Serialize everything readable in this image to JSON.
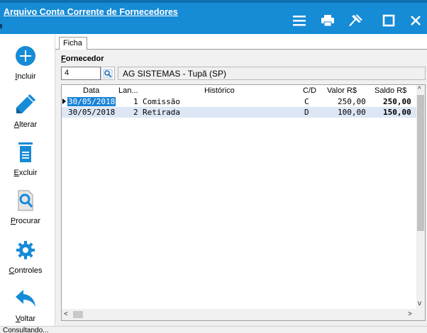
{
  "window": {
    "title": "Arquivo Conta Corrente de Fornecedores",
    "accent": "#168bd6",
    "buttons": [
      "menu-icon",
      "printer-icon",
      "pin-icon",
      "maximize-icon",
      "close-icon"
    ]
  },
  "sidebar": {
    "items": [
      {
        "label": "Incluir",
        "accel": "I",
        "rest": "ncluir",
        "icon": "plus-circle-icon"
      },
      {
        "label": "Alterar",
        "accel": "A",
        "rest": "lterar",
        "icon": "pencil-icon"
      },
      {
        "label": "Excluir",
        "accel": "E",
        "rest": "xcluir",
        "icon": "trash-icon"
      },
      {
        "label": "Procurar",
        "accel": "P",
        "rest": "rocurar",
        "icon": "search-document-icon"
      },
      {
        "label": "Controles",
        "accel": "C",
        "rest": "ontroles",
        "icon": "gear-icon"
      },
      {
        "label": "Voltar",
        "accel": "V",
        "rest": "oltar",
        "icon": "back-arrow-icon"
      }
    ]
  },
  "tabs": [
    {
      "label": "Ficha",
      "active": true
    }
  ],
  "form": {
    "fornecedor_label": "Fornecedor",
    "fornecedor_accel": "F",
    "fornecedor_rest": "ornecedor",
    "code_value": "4",
    "name_value": "AG SISTEMAS - Tupã (SP)"
  },
  "grid": {
    "columns": [
      "Data",
      "Lan...",
      "Histórico",
      "C/D",
      "Valor R$",
      "Saldo R$"
    ],
    "rows": [
      {
        "data": "30/05/2018",
        "lanc": "1",
        "historico": "Comissão",
        "cd": "C",
        "valor": "250,00",
        "saldo": "250,00",
        "selected": true
      },
      {
        "data": "30/05/2018",
        "lanc": "2",
        "historico": "Retirada",
        "cd": "D",
        "valor": "100,00",
        "saldo": "150,00",
        "selected": false
      }
    ]
  },
  "status": {
    "text": "Consultando..."
  }
}
